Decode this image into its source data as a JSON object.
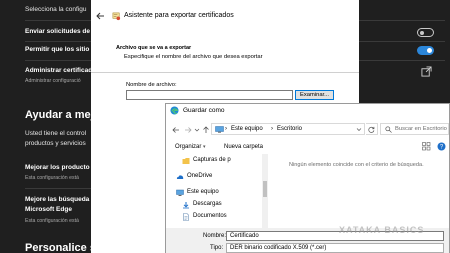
{
  "settings": {
    "row1": "Selecciona la configu",
    "row2_title": "Enviar solicitudes de",
    "row3_title": "Permitir que los sitio",
    "row4_title": "Administrar certificad",
    "row4_sub": "Administrar configuració",
    "section_title": "Ayudar a mejo",
    "section_text_1": "Usted tiene el control",
    "section_text_2": "productos y servicios",
    "improve_title": "Mejorar los producto",
    "improve_sub": "Esta configuración está",
    "search_title_1": "Mejore las búsqueda",
    "search_title_2": "Microsoft Edge",
    "search_sub": "Esta configuración está",
    "bottom_title": "Personalice su",
    "toggle_send": "off",
    "toggle_allow": "on",
    "accent_color": "#2b86d9"
  },
  "wizard": {
    "title": "Asistente para exportar certificados",
    "section_label": "Archivo que se va a exportar",
    "section_desc": "Especifique el nombre del archivo que desea exportar",
    "file_label": "Nombre de archivo:",
    "file_value": "",
    "browse_button": "Examinar..."
  },
  "save_dialog": {
    "title": "Guardar como",
    "breadcrumb": [
      "Este equipo",
      "Escritorio"
    ],
    "search_placeholder": "Buscar en Escritorio",
    "toolbar": {
      "organize": "Organizar",
      "new_folder": "Nueva carpeta"
    },
    "nav_items": [
      {
        "label": "Capturas de p",
        "icon": "folder-icon"
      },
      {
        "label": "OneDrive",
        "icon": "onedrive-icon"
      },
      {
        "label": "Este equipo",
        "icon": "computer-icon"
      },
      {
        "label": "Descargas",
        "icon": "downloads-icon"
      },
      {
        "label": "Documentos",
        "icon": "documents-icon"
      }
    ],
    "empty_message": "Ningún elemento coincide con el criterio de búsqueda.",
    "filename_label": "Nombre:",
    "filename_value": "Certificado",
    "type_label": "Tipo:",
    "type_value": "DER binario codificado X.509 (*.cer)"
  },
  "watermark": "XATAKA BASICS"
}
